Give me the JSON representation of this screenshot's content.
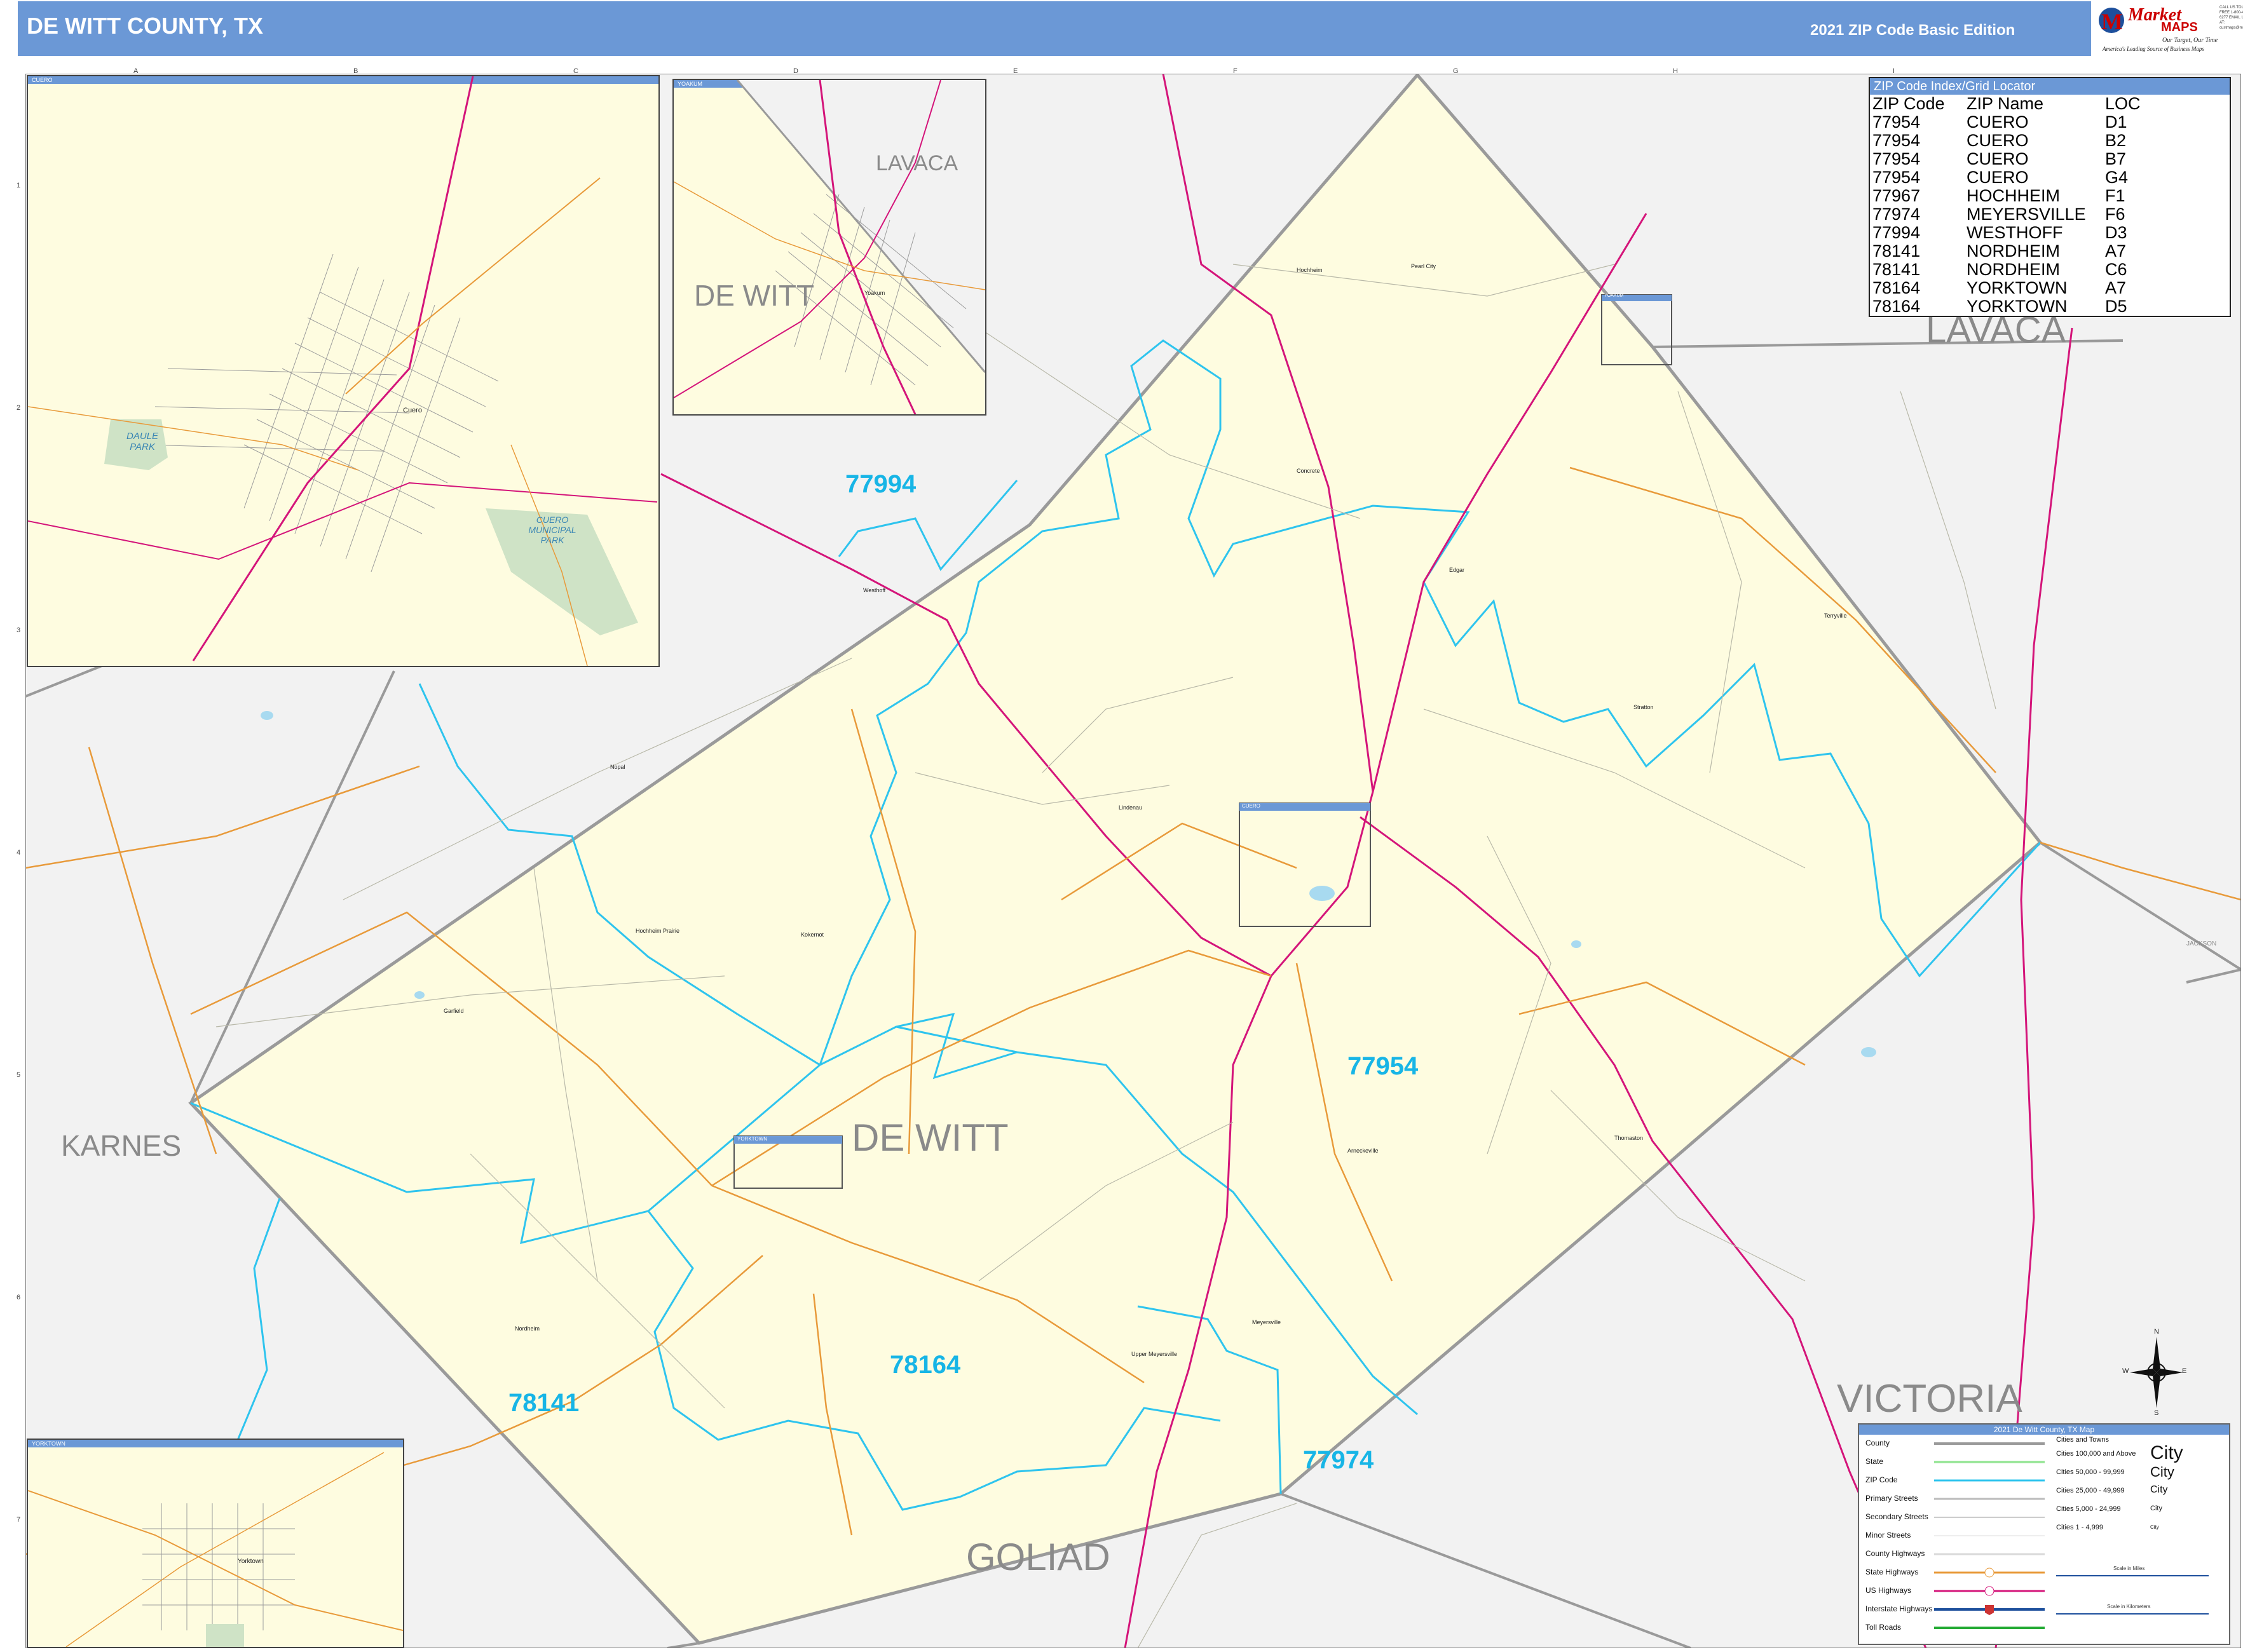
{
  "header": {
    "title": "DE WITT COUNTY, TX",
    "edition": "2021 ZIP Code Basic Edition",
    "logo_market": "Market",
    "logo_maps": "MAPS",
    "logo_tagline": "Our Target, Our Time",
    "logo_subtagline": "America's Leading Source of Business Maps",
    "logo_contact": "CALL US TOLL FREE 1-800-488-6277 EMAIL US AT: custmaps@marketmaps.com"
  },
  "grid": {
    "columns": [
      "A",
      "B",
      "C",
      "D",
      "E",
      "F",
      "G",
      "H",
      "I"
    ],
    "rows": [
      "1",
      "2",
      "3",
      "4",
      "5",
      "6",
      "7"
    ]
  },
  "map": {
    "county_labels": [
      "LAVACA",
      "LAVACA",
      "DE WITT",
      "DE WITT",
      "KARNES",
      "VICTORIA",
      "GOLIAD",
      "JACKSON"
    ],
    "zip_labels": [
      "77994",
      "77954",
      "78164",
      "78141",
      "77974"
    ],
    "towns": [
      "Westhoff",
      "Hochheim",
      "Meyersville",
      "Yorktown",
      "Nordheim",
      "Cuero",
      "Thomaston",
      "Edgar",
      "Arneckeville",
      "Lindenau",
      "Terryville",
      "Yoakum",
      "Concrete",
      "Nopal",
      "Upper Meyersville",
      "Garfield",
      "Kokernot",
      "Hochheim Prairie",
      "Stratton",
      "Pearl City"
    ],
    "colors": {
      "county_fill": "#fefce0",
      "outside_fill": "#f2f2f2",
      "county_border": "#9a9a9a",
      "zip_border": "#2ec4ee",
      "us_highway": "#d4157a",
      "state_highway": "#e89a3a",
      "water": "#a8daf0"
    }
  },
  "zip_index": {
    "title": "ZIP Code Index/Grid Locator",
    "columns": [
      "ZIP Code",
      "ZIP Name",
      "LOC"
    ],
    "rows": [
      [
        "77954",
        "CUERO",
        "D1"
      ],
      [
        "77954",
        "CUERO",
        "B2"
      ],
      [
        "77954",
        "CUERO",
        "B7"
      ],
      [
        "77954",
        "CUERO",
        "G4"
      ],
      [
        "77967",
        "HOCHHEIM",
        "F1"
      ],
      [
        "77974",
        "MEYERSVILLE",
        "F6"
      ],
      [
        "77994",
        "WESTHOFF",
        "D3"
      ],
      [
        "78141",
        "NORDHEIM",
        "A7"
      ],
      [
        "78141",
        "NORDHEIM",
        "C6"
      ],
      [
        "78164",
        "YORKTOWN",
        "A7"
      ],
      [
        "78164",
        "YORKTOWN",
        "D5"
      ]
    ]
  },
  "insets": {
    "cuero": {
      "title": "CUERO",
      "park1": "DAULE PARK",
      "park2": "CUERO MUNICIPAL PARK",
      "town": "Cuero"
    },
    "yoakum": {
      "title": "YOAKUM",
      "county1": "LAVACA",
      "county2": "DE WITT",
      "town": "Yoakum"
    },
    "yorktown": {
      "title": "YORKTOWN",
      "town": "Yorktown"
    },
    "small_boxes": [
      "YOAKUM",
      "CUERO",
      "YORKTOWN"
    ]
  },
  "legend": {
    "title": "2021 De Witt County, TX Map",
    "items": [
      "County",
      "State",
      "ZIP Code",
      "Primary Streets",
      "Secondary Streets",
      "Minor Streets",
      "County Highways",
      "State Highways",
      "US Highways",
      "Interstate Highways",
      "Toll Roads"
    ],
    "cities_header": "Cities and Towns",
    "cities": [
      {
        "range": "Cities 100,000 and Above",
        "sample": "City"
      },
      {
        "range": "Cities 50,000 - 99,999",
        "sample": "City"
      },
      {
        "range": "Cities 25,000 - 49,999",
        "sample": "City"
      },
      {
        "range": "Cities 5,000 - 24,999",
        "sample": "City"
      },
      {
        "range": "Cities 1 - 4,999",
        "sample": "City"
      }
    ],
    "scale_miles": "Scale in Miles",
    "scale_km": "Scale in Kilometers"
  },
  "compass": {
    "n": "N",
    "s": "S",
    "e": "E",
    "w": "W"
  }
}
